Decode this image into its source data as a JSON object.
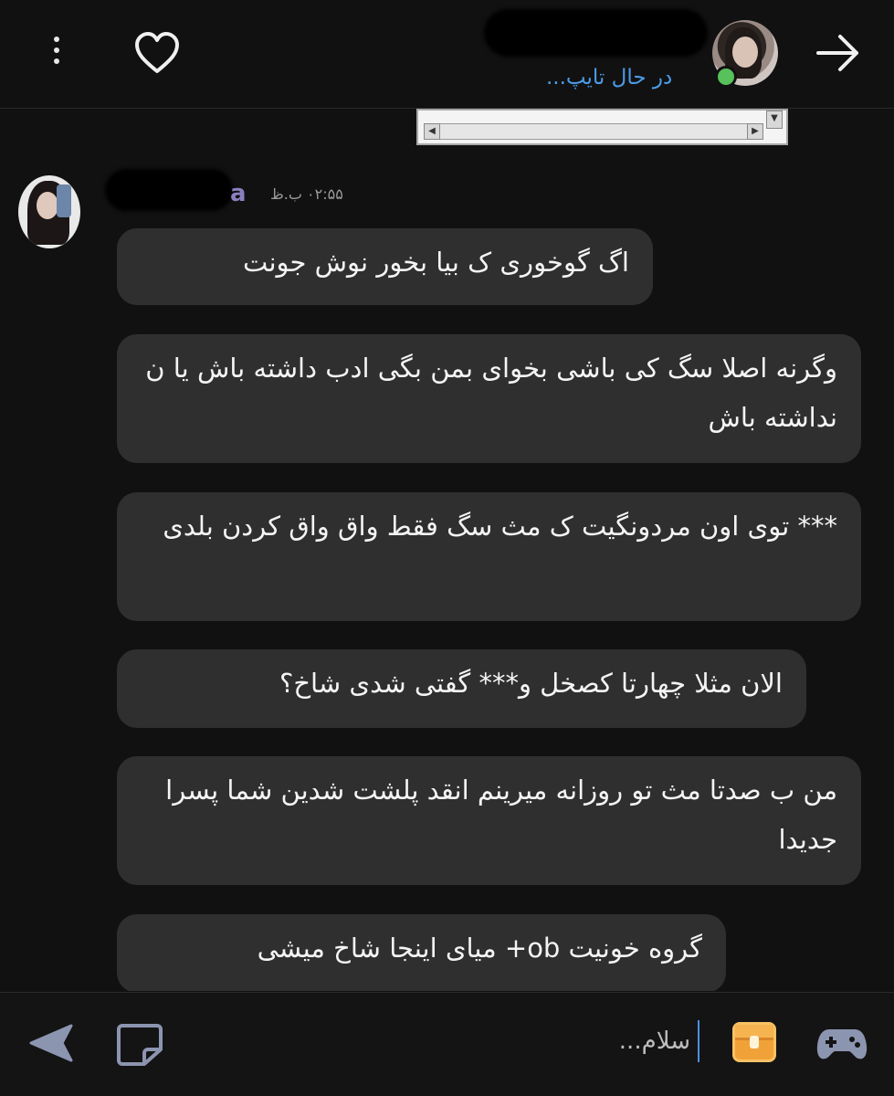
{
  "header": {
    "status": "در حال تایپ..."
  },
  "message_group": {
    "sender_name": "a",
    "timestamp": "۰۲:۵۵ ب.ظ",
    "messages": [
      "اگ گوخوری ک بیا بخور نوش جونت",
      "وگرنه اصلا سگ کی باشی بخوای بمن بگی ادب داشته باش یا ن نداشته باش",
      "*** توی اون مردونگیت ک مث سگ فقط واق واق کردن بلدی",
      "الان مثلا چهارتا کصخل و*** گفتی شدی شاخ؟",
      "من ب صدتا مث تو روزانه میرینم انقد پلشت شدین شما پسرا جدیدا",
      "گروه خونیت ob+ میای اینجا شاخ میشی"
    ]
  },
  "composer": {
    "placeholder": "سلام...",
    "value": ""
  },
  "colors": {
    "background": "#111111",
    "bubble": "#2f2f2f",
    "typing_status": "#4c9be8",
    "online": "#57c15b",
    "sender_name": "#8c7fbf"
  },
  "icons": {
    "header_left": [
      "menu-dots-icon",
      "heart-icon"
    ],
    "header_right": "back-arrow-icon",
    "composer": [
      "send-icon",
      "sticker-icon",
      "gift-icon",
      "gamepad-icon"
    ]
  }
}
